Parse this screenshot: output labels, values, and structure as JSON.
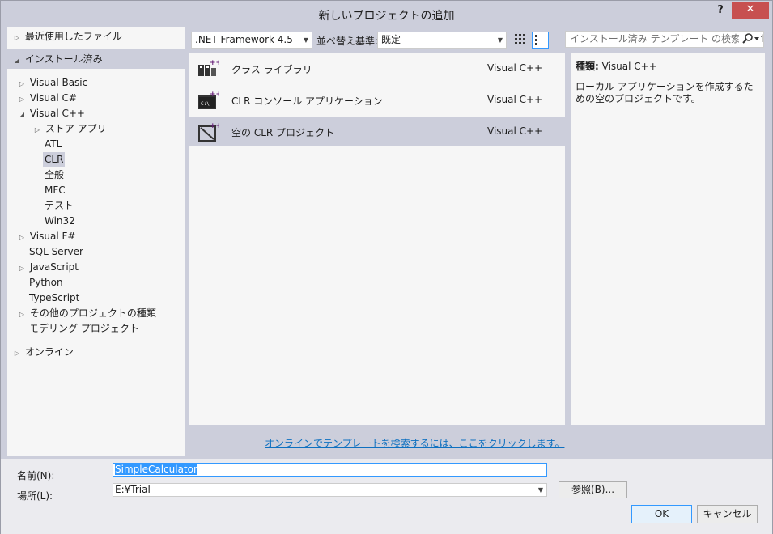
{
  "window": {
    "title": "新しいプロジェクトの追加",
    "help_label": "?",
    "close_label": "✕"
  },
  "tree": {
    "recent": "最近使用したファイル",
    "installed": "インストール済み",
    "visual_basic": "Visual Basic",
    "visual_csharp": "Visual C#",
    "visual_cpp": "Visual C++",
    "store_apps": "ストア アプリ",
    "atl": "ATL",
    "clr": "CLR",
    "general": "全般",
    "mfc": "MFC",
    "test": "テスト",
    "win32": "Win32",
    "visual_fsharp": "Visual F#",
    "sql_server": "SQL Server",
    "javascript": "JavaScript",
    "python": "Python",
    "typescript": "TypeScript",
    "other_types": "その他のプロジェクトの種類",
    "modeling": "モデリング プロジェクト",
    "online": "オンライン"
  },
  "toolbar": {
    "framework": ".NET Framework 4.5",
    "sort_label": "並べ替え基準:",
    "sort_value": "既定",
    "search_placeholder": "インストール済み テンプレート の検索 (Ctrl+E)"
  },
  "templates": [
    {
      "name": "クラス ライブラリ",
      "lang": "Visual C++"
    },
    {
      "name": "CLR コンソール アプリケーション",
      "lang": "Visual C++"
    },
    {
      "name": "空の CLR プロジェクト",
      "lang": "Visual C++"
    }
  ],
  "detail": {
    "type_label": "種類:",
    "type_value": "Visual C++",
    "description": "ローカル アプリケーションを作成するための空のプロジェクトです。"
  },
  "online_link": "オンラインでテンプレートを検索するには、ここをクリックします。",
  "form": {
    "name_label": "名前(N):",
    "name_value": "SimpleCalculator",
    "location_label": "場所(L):",
    "location_value": "E:¥Trial",
    "browse_label": "参照(B)...",
    "ok_label": "OK",
    "cancel_label": "キャンセル"
  },
  "colors": {
    "accent": "#3399ff",
    "selection": "#cccedb",
    "close": "#c75050",
    "link": "#0e70c0",
    "plus": "#68217a"
  }
}
